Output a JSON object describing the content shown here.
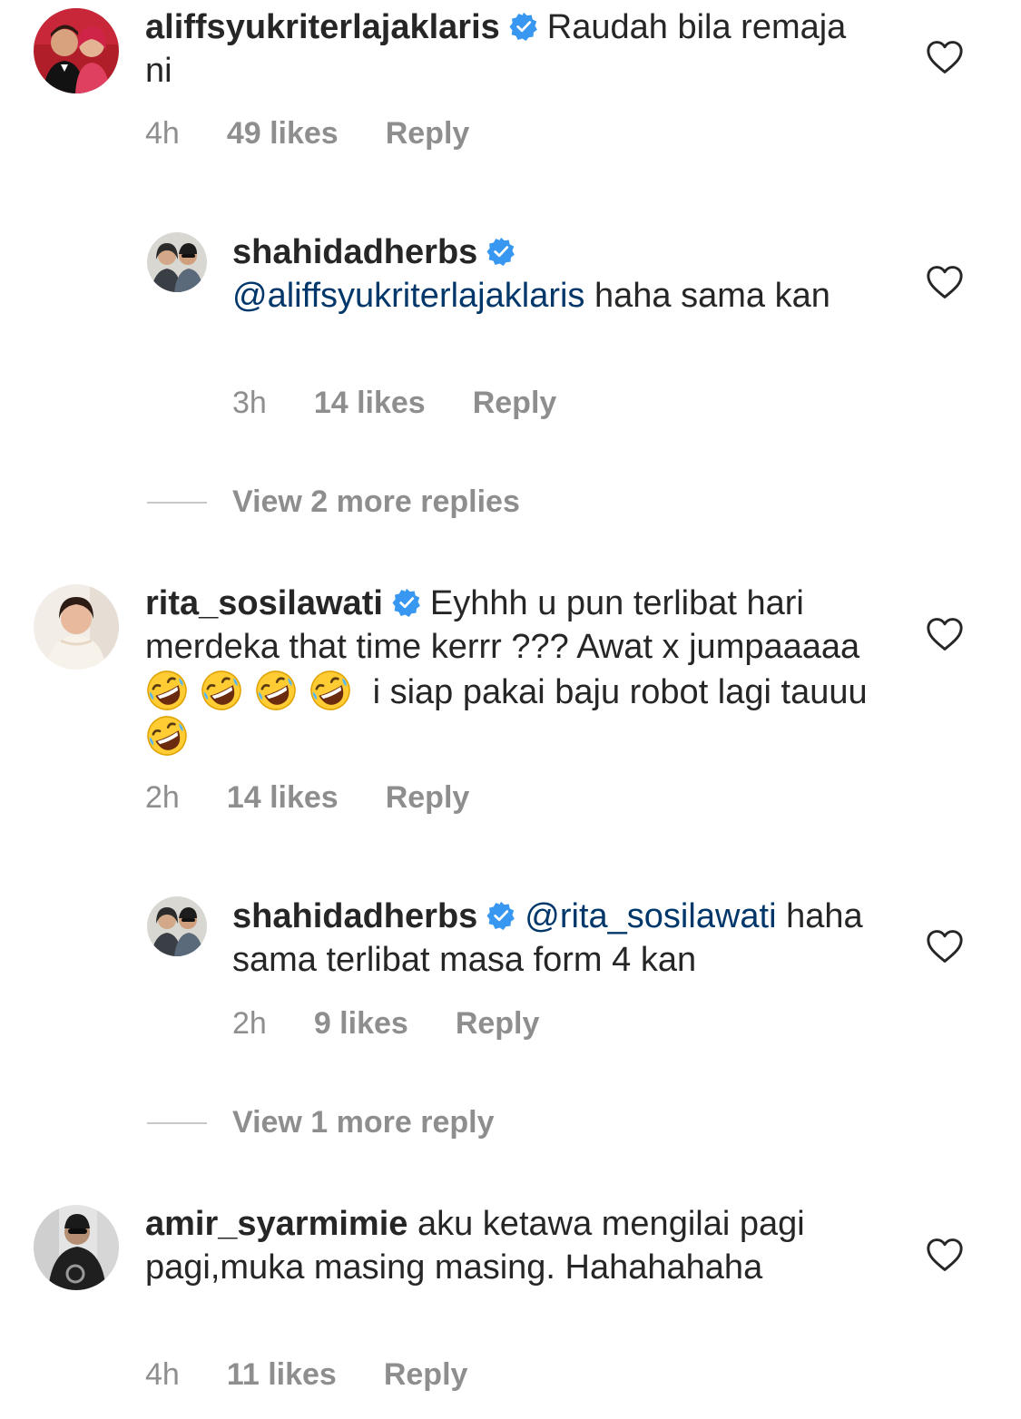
{
  "colors": {
    "text": "#262626",
    "secondary": "#8e8e8e",
    "mention": "#00376b",
    "verified": "#3897f0",
    "divider": "#c7c7c7"
  },
  "comments": [
    {
      "username": "aliffsyukriterlajaklaris",
      "verified": true,
      "text": "Raudah bila remaja ni",
      "time": "4h",
      "likes": "49 likes",
      "reply": "Reply"
    },
    {
      "username": "shahidadherbs",
      "verified": true,
      "mention": "@aliffsyukriterlajaklaris",
      "text": "haha sama kan",
      "time": "3h",
      "likes": "14 likes",
      "reply": "Reply"
    },
    {
      "username": "rita_sosilawati",
      "verified": true,
      "text_a": "Eyhhh u pun terlibat hari merdeka that time kerrr ??? Awat x jumpaaaaa",
      "text_b": "i siap pakai baju robot lagi tauuu",
      "emoji": "rolling-on-floor-laughing",
      "time": "2h",
      "likes": "14 likes",
      "reply": "Reply"
    },
    {
      "username": "shahidadherbs",
      "verified": true,
      "mention": "@rita_sosilawati",
      "text": "haha sama terlibat masa form 4 kan",
      "time": "2h",
      "likes": "9 likes",
      "reply": "Reply"
    },
    {
      "username": "amir_syarmimie",
      "verified": false,
      "text": "aku ketawa mengilai pagi pagi,muka masing masing. Hahahahaha",
      "time": "4h",
      "likes": "11 likes",
      "reply": "Reply"
    }
  ],
  "view_more": [
    {
      "label": "View 2 more replies"
    },
    {
      "label": "View 1 more reply"
    }
  ],
  "icons": {
    "like": "heart-outline-icon",
    "verified": "verified-badge-icon",
    "emoji": "rolling-on-floor-laughing-emoji"
  }
}
